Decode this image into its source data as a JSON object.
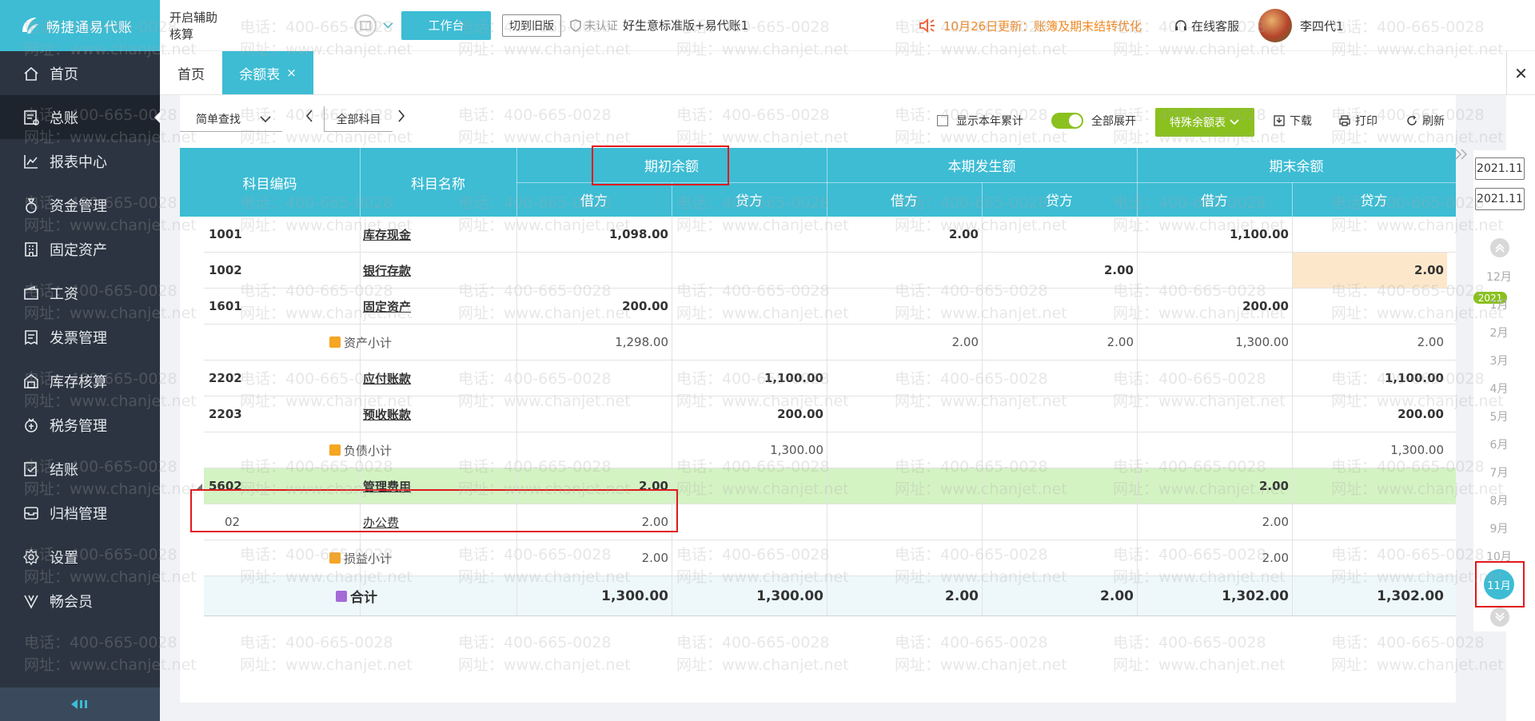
{
  "app": {
    "logo_text": "畅捷通易代账"
  },
  "sidebar": {
    "items": [
      {
        "label": "首页",
        "icon": "home-icon"
      },
      {
        "label": "总账",
        "icon": "ledger-icon"
      },
      {
        "label": "报表中心",
        "icon": "chart-icon"
      },
      {
        "label": "资金管理",
        "icon": "money-bag-icon"
      },
      {
        "label": "固定资产",
        "icon": "building-icon"
      },
      {
        "label": "工资",
        "icon": "wallet-icon"
      },
      {
        "label": "发票管理",
        "icon": "invoice-icon"
      },
      {
        "label": "库存核算",
        "icon": "warehouse-icon"
      },
      {
        "label": "税务管理",
        "icon": "tax-icon"
      },
      {
        "label": "结账",
        "icon": "checkout-icon"
      },
      {
        "label": "归档管理",
        "icon": "archive-icon"
      },
      {
        "label": "设置",
        "icon": "gear-icon"
      },
      {
        "label": "畅会员",
        "icon": "vip-icon"
      }
    ],
    "active_index": 1
  },
  "header": {
    "aux_toggle": "开启辅助核算",
    "workbench_button": "工作台",
    "old_version_button": "切到旧版",
    "cert_status": "未认证",
    "company": "好生意标准版+易代账1",
    "notice": "10月26日更新：账簿及期末结转优化",
    "service": "在线客服",
    "username": "李四代1"
  },
  "tabs": {
    "home": "首页",
    "active": "余额表",
    "close": "×",
    "close_all": "✕"
  },
  "toolbar": {
    "search_mode": "简单查找",
    "subject_filter": "全部科目",
    "show_year_total": "显示本年累计",
    "expand_all": "全部展开",
    "special_balance": "特殊余额表",
    "download": "下载",
    "print": "打印",
    "refresh": "刷新"
  },
  "table": {
    "headers": {
      "code": "科目编码",
      "name": "科目名称",
      "opening": "期初余额",
      "period": "本期发生额",
      "closing": "期末余额",
      "debit": "借方",
      "credit": "贷方"
    },
    "rows": [
      {
        "code": "1001",
        "name": "库存现金",
        "o_d": "1,098.00",
        "o_c": "",
        "p_d": "2.00",
        "p_c": "",
        "c_d": "1,100.00",
        "c_c": ""
      },
      {
        "code": "1002",
        "name": "银行存款",
        "o_d": "",
        "o_c": "",
        "p_d": "",
        "p_c": "2.00",
        "c_d": "",
        "c_c": "2.00"
      },
      {
        "code": "1601",
        "name": "固定资产",
        "o_d": "200.00",
        "o_c": "",
        "p_d": "",
        "p_c": "",
        "c_d": "200.00",
        "c_c": ""
      },
      {
        "code": "",
        "name": "资产小计",
        "o_d": "1,298.00",
        "o_c": "",
        "p_d": "2.00",
        "p_c": "2.00",
        "c_d": "1,300.00",
        "c_c": "2.00"
      },
      {
        "code": "2202",
        "name": "应付账款",
        "o_d": "",
        "o_c": "1,100.00",
        "p_d": "",
        "p_c": "",
        "c_d": "",
        "c_c": "1,100.00"
      },
      {
        "code": "2203",
        "name": "预收账款",
        "o_d": "",
        "o_c": "200.00",
        "p_d": "",
        "p_c": "",
        "c_d": "",
        "c_c": "200.00"
      },
      {
        "code": "",
        "name": "负债小计",
        "o_d": "",
        "o_c": "1,300.00",
        "p_d": "",
        "p_c": "",
        "c_d": "",
        "c_c": "1,300.00"
      },
      {
        "code": "5602",
        "name": "管理费用",
        "o_d": "2.00",
        "o_c": "",
        "p_d": "",
        "p_c": "",
        "c_d": "2.00",
        "c_c": ""
      },
      {
        "code": "02",
        "name": "办公费",
        "o_d": "2.00",
        "o_c": "",
        "p_d": "",
        "p_c": "",
        "c_d": "2.00",
        "c_c": ""
      },
      {
        "code": "",
        "name": "损益小计",
        "o_d": "2.00",
        "o_c": "",
        "p_d": "",
        "p_c": "",
        "c_d": "2.00",
        "c_c": ""
      }
    ],
    "total": {
      "name": "合计",
      "o_d": "1,300.00",
      "o_c": "1,300.00",
      "p_d": "2.00",
      "p_c": "2.00",
      "c_d": "1,302.00",
      "c_c": "1,302.00"
    }
  },
  "date_rail": {
    "start": "2021.11",
    "end": "2021.11",
    "year_badge": "2021",
    "months": [
      "12月",
      "1月",
      "2月",
      "3月",
      "4月",
      "5月",
      "6月",
      "7月",
      "8月",
      "9月",
      "10月"
    ],
    "current": "11月"
  },
  "watermark": {
    "phone": "电话：400-665-0028",
    "site": "网址：www.chanjet.net"
  },
  "colors": {
    "brand": "#3dbcd4",
    "accent_green": "#8ac11e",
    "sidebar": "#2b3440",
    "notice": "#f08a24",
    "highlight_red": "#e0191c"
  }
}
